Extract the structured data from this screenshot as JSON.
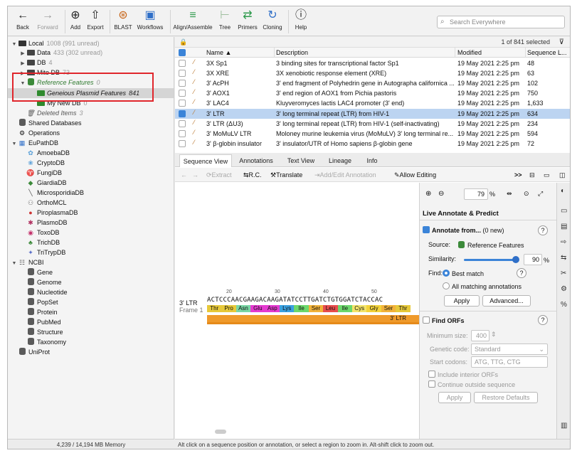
{
  "toolbar": {
    "back": "Back",
    "forward": "Forward",
    "add": "Add",
    "export": "Export",
    "blast": "BLAST",
    "workflows": "Workflows",
    "align": "Align/Assemble",
    "tree": "Tree",
    "primers": "Primers",
    "cloning": "Cloning",
    "help": "Help",
    "search_placeholder": "Search Everywhere"
  },
  "sidebar": {
    "local": {
      "label": "Local",
      "count": "1008 (991 unread)"
    },
    "data": {
      "label": "Data",
      "count": "433 (302 unread)"
    },
    "db": {
      "label": "DB",
      "count": "4"
    },
    "mito": {
      "label": "Mito DB",
      "count": "73"
    },
    "ref": {
      "label": "Reference Features",
      "count": "0"
    },
    "plasmid": {
      "label": "Geneious Plasmid Features",
      "count": "841"
    },
    "mynew": {
      "label": "My New DB",
      "count": "0"
    },
    "deleted": {
      "label": "Deleted Items",
      "count": "3"
    },
    "shared": "Shared Databases",
    "operations": "Operations",
    "eupath": "EuPathDB",
    "eupath_items": [
      "AmoebaDB",
      "CryptoDB",
      "FungiDB",
      "GiardiaDB",
      "MicrosporidiaDB",
      "OrthoMCL",
      "PiroplasmaDB",
      "PlasmoDB",
      "ToxoDB",
      "TrichDB",
      "TriTrypDB"
    ],
    "ncbi": "NCBI",
    "ncbi_items": [
      "Gene",
      "Genome",
      "Nucleotide",
      "PopSet",
      "Protein",
      "PubMed",
      "Structure",
      "Taxonomy"
    ],
    "uniprot": "UniProt",
    "memory": "4,239 / 14,194 MB Memory"
  },
  "table": {
    "selected": "1 of 841 selected",
    "headers": {
      "name": "Name",
      "description": "Description",
      "modified": "Modified",
      "length": "Sequence L..."
    },
    "rows": [
      {
        "name": "3X Sp1",
        "description": "3 binding sites for transcriptional factor Sp1",
        "modified": "19 May 2021 2:25 pm",
        "length": "48"
      },
      {
        "name": "3X XRE",
        "description": "3X xenobiotic response element (XRE)",
        "modified": "19 May 2021 2:25 pm",
        "length": "63"
      },
      {
        "name": "3' AcPH",
        "description": "3' end fragment of Polyhedrin gene in Autographa californica ...",
        "modified": "19 May 2021 2:25 pm",
        "length": "102"
      },
      {
        "name": "3' AOX1",
        "description": "3' end region of AOX1 from Pichia pastoris",
        "modified": "19 May 2021 2:25 pm",
        "length": "750"
      },
      {
        "name": "3' LAC4",
        "description": "Kluyveromyces lactis LAC4 promoter (3' end)",
        "modified": "19 May 2021 2:25 pm",
        "length": "1,633"
      },
      {
        "name": "3' LTR",
        "description": "3' long terminal repeat (LTR) from HIV-1",
        "modified": "19 May 2021 2:25 pm",
        "length": "634"
      },
      {
        "name": "3' LTR (ΔU3)",
        "description": "3' long terminal repeat (LTR) from HIV-1 (self-inactivating)",
        "modified": "19 May 2021 2:25 pm",
        "length": "234"
      },
      {
        "name": "3' MoMuLV LTR",
        "description": "Moloney murine leukemia virus (MoMuLV) 3' long terminal re...",
        "modified": "19 May 2021 2:25 pm",
        "length": "594"
      },
      {
        "name": "3' β-globin insulator",
        "description": "3' insulator/UTR of Homo sapiens β-globin gene",
        "modified": "19 May 2021 2:25 pm",
        "length": "72"
      }
    ]
  },
  "tabs": [
    "Sequence View",
    "Annotations",
    "Text View",
    "Lineage",
    "Info"
  ],
  "seqbar": {
    "extract": "Extract",
    "rc": "R.C.",
    "translate": "Translate",
    "add_edit": "Add/Edit Annotation",
    "allow": "Allow Editing",
    "more": ">>"
  },
  "viewer": {
    "seq_name": "3' LTR",
    "frame": "Frame 1",
    "sequence": "ACTCCCAACGAAGACAAGATATCCTTGATCTGTGGATCTACCAC",
    "ruler": [
      "20",
      "30",
      "40",
      "50"
    ],
    "aa": [
      "Thr",
      "Pro",
      "Asn",
      "Glu",
      "Asp",
      "Lys",
      "Ile",
      "Ser",
      "Leu",
      "Ile",
      "Cys",
      "Gly",
      "Ser",
      "Thr"
    ],
    "aa_colors": [
      "#e7c93a",
      "#e7c93a",
      "#7ad6a5",
      "#e53ad0",
      "#e53ad0",
      "#3aa0e0",
      "#6cd86c",
      "#f2b23a",
      "#e84d4d",
      "#6cd86c",
      "#f3e46a",
      "#f3d33a",
      "#f2b23a",
      "#e7c93a"
    ],
    "annotation": "3' LTR",
    "zoom": "79"
  },
  "panel": {
    "title": "Live Annotate & Predict",
    "annotate_from": "Annotate from...",
    "new_count": "(0 new)",
    "source_label": "Source:",
    "source_value": "Reference Features",
    "similarity_label": "Similarity:",
    "similarity_value": "90",
    "similarity_unit": "%",
    "find_label": "Find:",
    "best_match": "Best match",
    "all_matching": "All matching annotations",
    "apply": "Apply",
    "advanced": "Advanced...",
    "find_orfs": "Find ORFs",
    "min_size_label": "Minimum size:",
    "min_size_value": "400",
    "genetic_code_label": "Genetic code:",
    "genetic_code_value": "Standard",
    "start_codons_label": "Start codons:",
    "start_codons_value": "ATG, TTG, CTG",
    "include_interior": "Include interior ORFs",
    "continue_outside": "Continue outside sequence",
    "apply2": "Apply",
    "restore": "Restore Defaults"
  },
  "status": "Alt click on a sequence position or annotation, or select a region to zoom in. Alt-shift click to zoom out."
}
